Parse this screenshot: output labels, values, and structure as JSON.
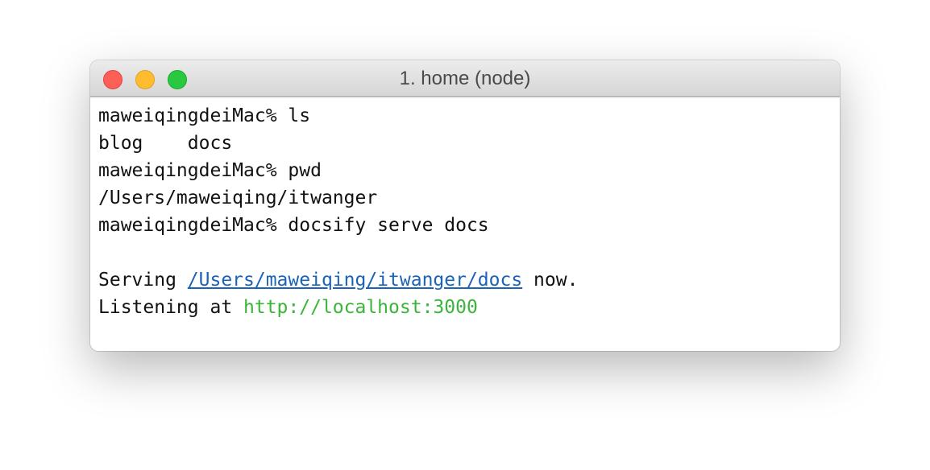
{
  "window": {
    "title": "1. home (node)",
    "buttons": {
      "close": "close-icon",
      "minimize": "minimize-icon",
      "zoom": "zoom-icon"
    }
  },
  "terminal": {
    "lines": [
      "maweiqingdeiMac% ls",
      "blog    docs",
      "maweiqingdeiMac% pwd",
      "/Users/maweiqing/itwanger",
      "maweiqingdeiMac% docsify serve docs",
      ""
    ],
    "serving": {
      "prefix": "Serving ",
      "path": "/Users/maweiqing/itwanger/docs",
      "suffix": " now."
    },
    "listening": {
      "prefix": "Listening at ",
      "url": "http://localhost:3000"
    }
  },
  "colors": {
    "close": "#fe5f57",
    "minimize": "#febc2e",
    "zoom": "#28c840",
    "link": "#1a63b8",
    "url": "#3ab53a"
  }
}
